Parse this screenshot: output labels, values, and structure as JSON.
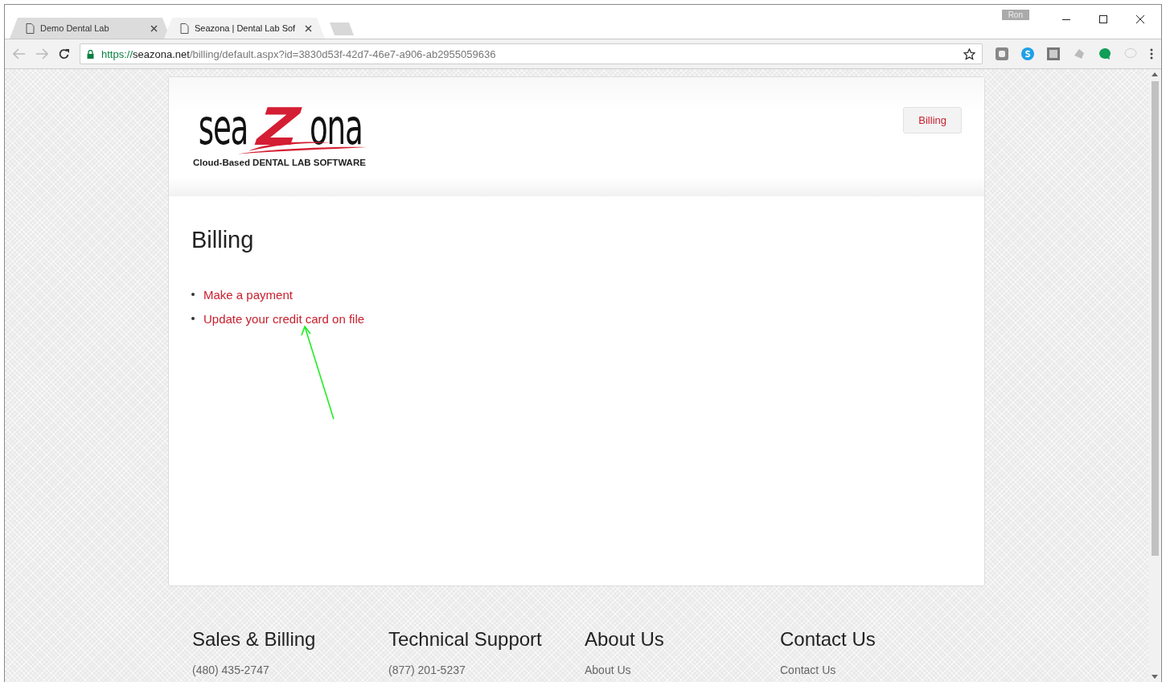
{
  "browser": {
    "profile": "Ron",
    "tabs": [
      {
        "title": "Demo Dental Lab",
        "selected": false
      },
      {
        "title": "Seazona | Dental Lab Sof",
        "selected": true
      }
    ],
    "url": {
      "scheme": "https://",
      "host": "seazona.net",
      "path": "/billing/default.aspx?id=3830d53f-42d7-46e7-a906-ab2955059636"
    }
  },
  "header": {
    "logo": {
      "left": "sea",
      "mark": "Z",
      "right": "ona",
      "tagline": "Cloud-Based DENTAL LAB SOFTWARE"
    },
    "nav": [
      {
        "label": "Billing"
      }
    ]
  },
  "content": {
    "title": "Billing",
    "links": [
      "Make a payment",
      "Update your credit card on file"
    ]
  },
  "footer": {
    "columns": [
      {
        "heading": "Sales & Billing",
        "item": "(480) 435-2747"
      },
      {
        "heading": "Technical Support",
        "item": "(877) 201-5237"
      },
      {
        "heading": "About Us",
        "item": "About Us"
      },
      {
        "heading": "Contact Us",
        "item": "Contact Us"
      }
    ]
  }
}
